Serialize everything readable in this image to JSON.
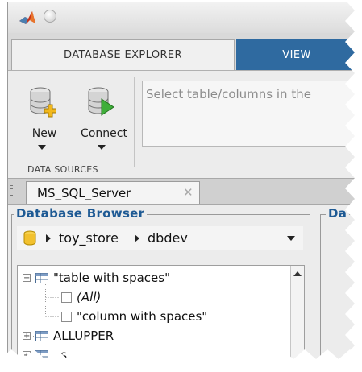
{
  "window": {
    "logo_icon": "matlab-logo-icon",
    "title_button_icon": "window-circle-icon"
  },
  "tabs": [
    {
      "label": "DATABASE EXPLORER",
      "active": true
    },
    {
      "label": "VIEW",
      "active": false
    }
  ],
  "toolstrip": {
    "new": {
      "label": "New",
      "icon": "new-database-icon"
    },
    "connect": {
      "label": "Connect",
      "icon": "connect-database-icon"
    },
    "group_label": "DATA SOURCES",
    "hint": "Select table/columns in the"
  },
  "document_tab": {
    "label": "MS_SQL_Server",
    "close_glyph": "✕"
  },
  "database_browser": {
    "title": "Database Browser",
    "path": [
      "toy_store",
      "dbdev"
    ],
    "tree": [
      {
        "label": "\"table with spaces\"",
        "expander": "−",
        "type": "table"
      },
      {
        "label": "(All)",
        "type": "column-checkbox",
        "italic": true
      },
      {
        "label": "\"column with spaces\"",
        "type": "column-checkbox"
      },
      {
        "label": "ALLUPPER",
        "expander": "+",
        "type": "table"
      },
      {
        "label": "as",
        "expander": "+",
        "type": "table"
      }
    ]
  },
  "right_panel": {
    "title_fragment": "Da"
  },
  "colors": {
    "accent_blue": "#2f6aa0",
    "panel_title_blue": "#1e5a94"
  }
}
